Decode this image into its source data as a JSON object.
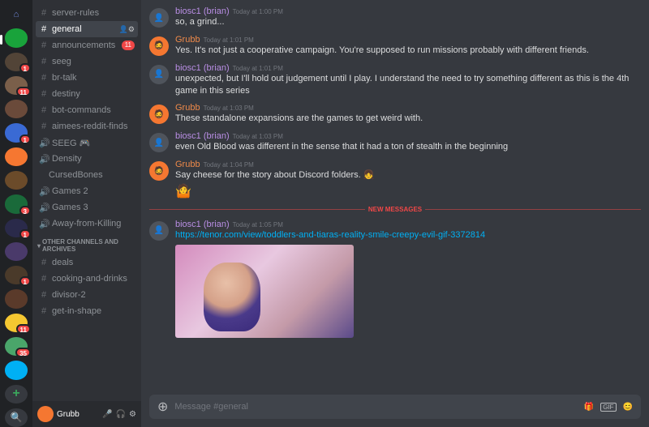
{
  "servers": [
    {
      "name": "home",
      "badge": null,
      "color": "#202225",
      "active": false
    },
    {
      "name": "s1",
      "badge": null,
      "color": "#19a33b",
      "active": true
    },
    {
      "name": "s2",
      "badge": "1",
      "color": "#524437",
      "active": false
    },
    {
      "name": "s3",
      "badge": "11",
      "color": "#7a5f4a",
      "active": false
    },
    {
      "name": "s4",
      "badge": null,
      "color": "#6a4a3a",
      "active": false
    },
    {
      "name": "s5",
      "badge": "1",
      "color": "#3a6ad4",
      "active": false
    },
    {
      "name": "s6",
      "badge": null,
      "color": "#f57731",
      "active": false
    },
    {
      "name": "s7",
      "badge": null,
      "color": "#6b4b2a",
      "active": false
    },
    {
      "name": "s8",
      "badge": "3",
      "color": "#1a6a3a",
      "active": false
    },
    {
      "name": "s9",
      "badge": "1",
      "color": "#2a2a4a",
      "active": false
    },
    {
      "name": "s10",
      "badge": null,
      "color": "#4a3a6a",
      "active": false
    },
    {
      "name": "s11",
      "badge": "1",
      "color": "#4a3a2a",
      "active": false
    },
    {
      "name": "s12",
      "badge": null,
      "color": "#5a3a2a",
      "active": false
    },
    {
      "name": "s13",
      "badge": "11",
      "color": "#f5c731",
      "active": false
    },
    {
      "name": "s14",
      "badge": "35",
      "color": "#4aa56a",
      "active": false
    },
    {
      "name": "s15",
      "badge": null,
      "color": "#00b0f4",
      "active": false
    }
  ],
  "actions": {
    "add_server": "+",
    "discover": "🔍"
  },
  "channels": [
    {
      "type": "text",
      "name": "server-rules",
      "selected": false
    },
    {
      "type": "text",
      "name": "general",
      "selected": true,
      "settings": true
    },
    {
      "type": "text",
      "name": "announcements",
      "selected": false,
      "badge": "11"
    },
    {
      "type": "text",
      "name": "seeg",
      "selected": false
    },
    {
      "type": "text",
      "name": "br-talk",
      "selected": false
    },
    {
      "type": "text",
      "name": "destiny",
      "selected": false
    },
    {
      "type": "text",
      "name": "bot-commands",
      "selected": false
    },
    {
      "type": "text",
      "name": "aimees-reddit-finds",
      "selected": false
    },
    {
      "type": "voice",
      "name": "SEEG",
      "selected": false,
      "extra": "🎮"
    },
    {
      "type": "voice",
      "name": "Density",
      "selected": false
    },
    {
      "type": "user",
      "name": "CursedBones",
      "selected": false
    },
    {
      "type": "voice",
      "name": "Games 2",
      "selected": false
    },
    {
      "type": "voice",
      "name": "Games 3",
      "selected": false
    },
    {
      "type": "voice",
      "name": "Away-from-Killing",
      "selected": false
    }
  ],
  "category_label": "OTHER CHANNELS AND ARCHIVES",
  "archive_channels": [
    {
      "type": "text",
      "name": "deals"
    },
    {
      "type": "text",
      "name": "cooking-and-drinks"
    },
    {
      "type": "text",
      "name": "divisor-2"
    },
    {
      "type": "text",
      "name": "get-in-shape"
    }
  ],
  "user": {
    "name": "Grubb",
    "icons": {
      "mic": "🎤",
      "headphones": "🎧",
      "settings": "⚙"
    }
  },
  "messages": [
    {
      "author": "biosc1 (brian)",
      "class": "biosc",
      "ts": "Today at 1:00 PM",
      "text": "so, a grind..."
    },
    {
      "author": "Grubb",
      "class": "grubb",
      "ts": "Today at 1:01 PM",
      "text": "Yes. It's not just a cooperative campaign. You're supposed to run missions probably with different friends."
    },
    {
      "author": "biosc1 (brian)",
      "class": "biosc",
      "ts": "Today at 1:01 PM",
      "text": "unexpected, but I'll hold out judgement until I play.  I understand the need to try something different as this is the 4th game in this series"
    },
    {
      "author": "Grubb",
      "class": "grubb",
      "ts": "Today at 1:03 PM",
      "text": "These standalone expansions are the games to get weird with."
    },
    {
      "author": "biosc1 (brian)",
      "class": "biosc",
      "ts": "Today at 1:03 PM",
      "text": "even Old Blood was different in the sense that it had a ton of stealth in the beginning"
    },
    {
      "author": "Grubb",
      "class": "grubb",
      "ts": "Today at 1:04 PM",
      "text": "Say cheese for the story about Discord folders.",
      "emoji": "👧",
      "reaction": "🤷"
    }
  ],
  "divider_label": "NEW MESSAGES",
  "link_message": {
    "author": "biosc1 (brian)",
    "class": "biosc",
    "ts": "Today at 1:05 PM",
    "link": "https://tenor.com/view/toddlers-and-tiaras-reality-smile-creepy-evil-gif-3372814"
  },
  "input": {
    "placeholder": "Message #general",
    "icons": {
      "gift": "🎁",
      "gif": "GIF",
      "emoji": "😊"
    }
  }
}
